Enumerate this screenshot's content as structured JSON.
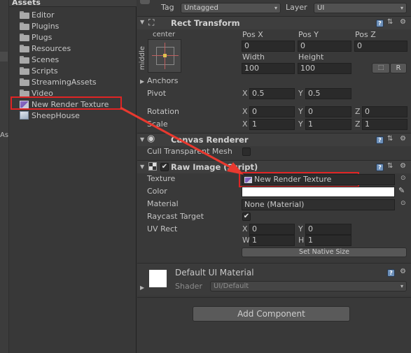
{
  "project": {
    "title": "Assets",
    "folders": [
      "Editor",
      "Plugins",
      "Plugs",
      "Resources",
      "Scenes",
      "Scripts",
      "StreamingAssets",
      "Video"
    ],
    "selected_item": "New Render Texture",
    "prefab_item": "SheepHouse",
    "strip_label": "As"
  },
  "inspector": {
    "tag_label": "Tag",
    "tag_value": "Untagged",
    "layer_label": "Layer",
    "layer_value": "UI",
    "rect_transform": {
      "title": "Rect Transform",
      "anchor_h": "center",
      "anchor_v": "middle",
      "pos_x_label": "Pos X",
      "pos_y_label": "Pos Y",
      "pos_z_label": "Pos Z",
      "pos_x": "0",
      "pos_y": "0",
      "pos_z": "0",
      "width_label": "Width",
      "height_label": "Height",
      "width": "100",
      "height": "100",
      "r_button": "R",
      "anchors_label": "Anchors",
      "pivot_label": "Pivot",
      "pivot_x": "0.5",
      "pivot_y": "0.5",
      "rotation_label": "Rotation",
      "rot_x": "0",
      "rot_y": "0",
      "rot_z": "0",
      "scale_label": "Scale",
      "scale_x": "1",
      "scale_y": "1",
      "scale_z": "1",
      "x": "X",
      "y": "Y",
      "z": "Z"
    },
    "canvas_renderer": {
      "title": "Canvas Renderer",
      "cull_label": "Cull Transparent Mesh"
    },
    "raw_image": {
      "title": "Raw Image (Script)",
      "texture_label": "Texture",
      "texture_value": "New Render Texture",
      "color_label": "Color",
      "color_value": "#ffffff",
      "material_label": "Material",
      "material_value": "None (Material)",
      "raycast_label": "Raycast Target",
      "raycast_checked": "✔",
      "uvrect_label": "UV Rect",
      "uv_x": "0",
      "uv_y": "0",
      "uv_w": "1",
      "uv_h": "1",
      "w": "W",
      "h": "H",
      "native_size_button": "Set Native Size"
    },
    "material": {
      "name": "Default UI Material",
      "shader_label": "Shader",
      "shader_value": "UI/Default"
    },
    "add_component": "Add Component",
    "help_glyph": "?"
  },
  "colors": {
    "highlight": "#e02424",
    "arrow": "#e8392f"
  }
}
